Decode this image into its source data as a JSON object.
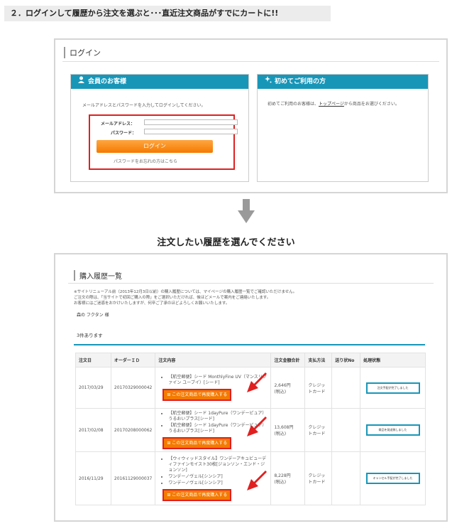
{
  "step_title": "２．ログインして履歴から注文を選ぶと･･･直近注文商品がすでにカートに!!",
  "login": {
    "title": "ログイン",
    "member": {
      "header": "会員のお客様",
      "instruction": "メールアドレスとパスワードを入力してログインしてください。",
      "email_label": "メールアドレス：",
      "password_label": "パスワード：",
      "email_value": "",
      "button": "ログイン",
      "forgot": "パスワードをお忘れの方はこちら"
    },
    "first": {
      "header": "初めてご利用の方",
      "text_before": "初めてご利用のお客様は、",
      "link": "トップページ",
      "text_after": "から商品をお選びください。"
    }
  },
  "heading": "注文したい履歴を選んでください",
  "history": {
    "title": "購入履歴一覧",
    "notes": [
      "※サイトリニューアル前（2013年12月3日以前）の購入履歴については、マイページの購入履歴一覧でご確認いただけません。",
      "ご注文の際は、「当サイトで初回ご購入の際」をご選択いただければ、後ほどメールで案内をご連絡いたします。",
      "お客様にはご迷惑をおかけいたしますが、何卒ご了承のほどよろしくお願いいたします。"
    ],
    "customer": "森の フクタン 様",
    "count": "3件あります",
    "columns": [
      "注文日",
      "オーダーＩＤ",
      "注文内容",
      "注文金額合計",
      "支払方法",
      "送り状No",
      "処理状態"
    ],
    "reorder_label": "この注文商品で再度購入する",
    "rows": [
      {
        "date": "2017/03/29",
        "order_id": "20170329000042",
        "items": [
          "【航空郵便】シード MonthlyFine UV（マンスリファイン ユーブイ）[シード]"
        ],
        "amount": "2,646円",
        "tax": "(税込)",
        "payment": "クレジットカード",
        "tracking": "",
        "status": "注文手配が完了しました"
      },
      {
        "date": "2017/02/08",
        "order_id": "20170208000062",
        "items": [
          "【航空郵便】シード 1dayPure（ワンデーピュア）うるおいプラス[シード]",
          "【航空郵便】シード 1dayPure（ワンデーピュア）うるおいプラス[シード]"
        ],
        "amount": "13,608円",
        "tax": "(税込)",
        "payment": "クレジットカード",
        "tracking": "",
        "status": "商品を発送致しました"
      },
      {
        "date": "2016/11/29",
        "order_id": "20161129000037",
        "items": [
          "【ウィウィッドスタイル】ワンデーアキュビューディファインモイスト30枚[ジョンソン・エンド・ジョンソン]",
          "ワンデーノヴェル[シンシア]",
          "ワンデーノヴェル[シンシア]"
        ],
        "amount": "8,228円",
        "tax": "(税込)",
        "payment": "クレジットカード",
        "tracking": "",
        "status": "キャンセル手配が完了しました"
      }
    ]
  },
  "colors": {
    "accent": "#1896b8",
    "orange": "#f47a00",
    "highlight": "#e02020"
  }
}
